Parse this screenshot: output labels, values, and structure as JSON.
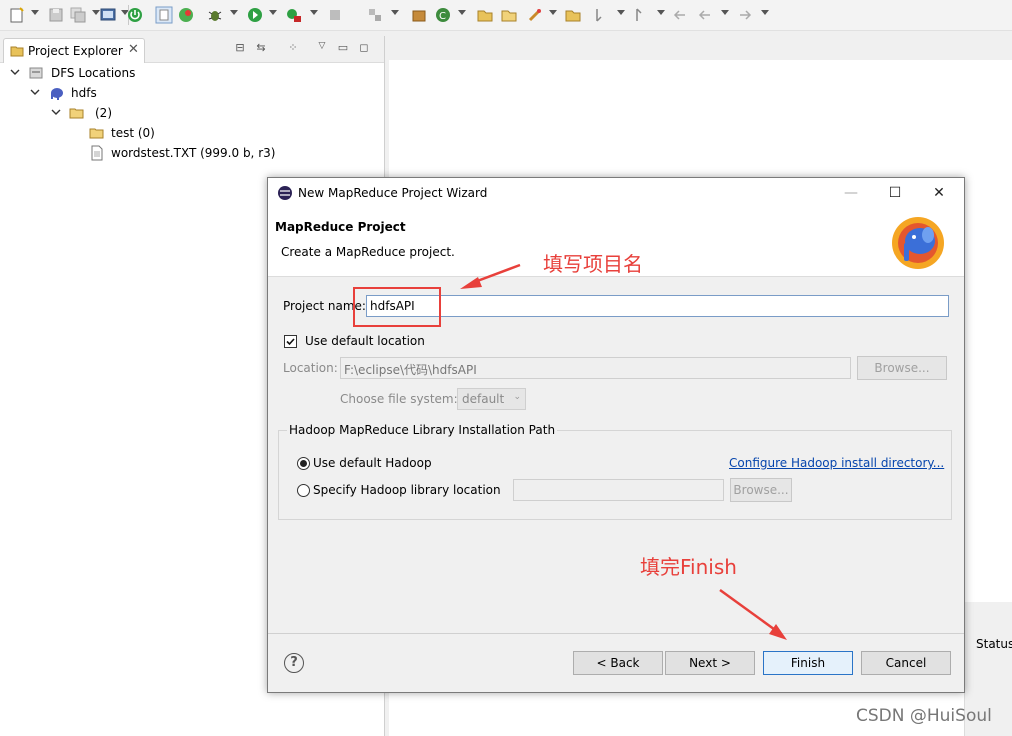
{
  "explorer": {
    "tab_label": "Project Explorer",
    "tree": [
      {
        "label": "DFS Locations",
        "icon": "dfs-locations-icon"
      },
      {
        "label": "hdfs",
        "icon": "elephant-icon"
      },
      {
        "label": "(2)",
        "icon": "folder-open-icon"
      },
      {
        "label": "test (0)",
        "icon": "folder-icon"
      },
      {
        "label": "wordstest.TXT (999.0 b, r3)",
        "icon": "file-icon"
      }
    ]
  },
  "status_column": "Status",
  "dialog": {
    "title": "New MapReduce Project Wizard",
    "banner_title": "MapReduce Project",
    "banner_description": "Create a MapReduce project.",
    "project_name_label": "Project name:",
    "project_name_value": "hdfsAPI",
    "use_default_location_label": "Use default location",
    "use_default_location_checked": true,
    "location_label": "Location:",
    "location_value": "F:\\eclipse\\代码\\hdfsAPI",
    "browse_label": "Browse...",
    "file_system_label": "Choose file system:",
    "file_system_value": "default",
    "hadoop_group_title": "Hadoop MapReduce Library Installation Path",
    "use_default_hadoop_label": "Use default Hadoop",
    "specify_hadoop_label": "Specify Hadoop library location",
    "configure_link": "Configure Hadoop install directory...",
    "hadoop_browse_label": "Browse...",
    "buttons": {
      "back": "< Back",
      "next": "Next >",
      "finish": "Finish",
      "cancel": "Cancel"
    }
  },
  "annotations": {
    "fill_name": "填写项目名",
    "fill_finish": "填完Finish"
  },
  "watermark": "CSDN @HuiSoul",
  "colors": {
    "annotation_red": "#e8403b",
    "link_blue": "#0645ad",
    "focus_blue": "#2a74c7"
  }
}
